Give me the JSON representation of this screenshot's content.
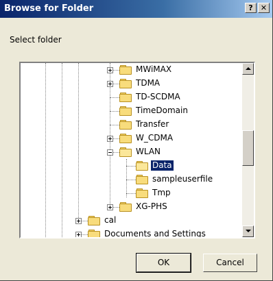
{
  "window": {
    "title": "Browse for Folder",
    "help_label": "?",
    "close_label": "✕"
  },
  "prompt": "Select folder",
  "tree": {
    "items": [
      {
        "label": "MWiMAX",
        "expander": "plus",
        "selected": false
      },
      {
        "label": "TDMA",
        "expander": "plus",
        "selected": false
      },
      {
        "label": "TD-SCDMA",
        "expander": "none",
        "selected": false
      },
      {
        "label": "TimeDomain",
        "expander": "none",
        "selected": false
      },
      {
        "label": "Transfer",
        "expander": "none",
        "selected": false
      },
      {
        "label": "W_CDMA",
        "expander": "plus",
        "selected": false
      },
      {
        "label": "WLAN",
        "expander": "minus",
        "selected": false
      },
      {
        "label": "Data",
        "expander": "none",
        "selected": true
      },
      {
        "label": "sampleuserfile",
        "expander": "none",
        "selected": false
      },
      {
        "label": "Tmp",
        "expander": "none",
        "selected": false
      },
      {
        "label": "XG-PHS",
        "expander": "plus",
        "selected": false
      },
      {
        "label": "cal",
        "expander": "plus",
        "selected": false
      },
      {
        "label": "Documents and Settings",
        "expander": "plus",
        "selected": false
      }
    ]
  },
  "buttons": {
    "ok": "OK",
    "cancel": "Cancel"
  }
}
